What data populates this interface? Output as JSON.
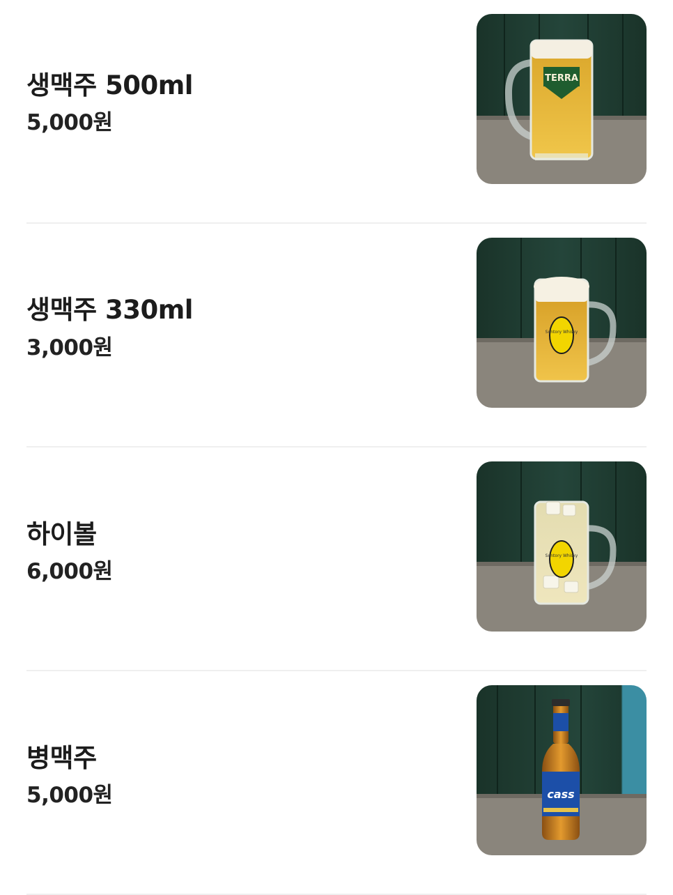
{
  "menu": {
    "items": [
      {
        "name": "생맥주 500ml",
        "price": "5,000원",
        "image_icon": "draft-beer-mug-icon",
        "label_text": "TERRA"
      },
      {
        "name": "생맥주 330ml",
        "price": "3,000원",
        "image_icon": "small-beer-mug-icon",
        "label_text": "Suntory Whisky"
      },
      {
        "name": "하이볼",
        "price": "6,000원",
        "image_icon": "highball-mug-icon",
        "label_text": "Suntory Whisky"
      },
      {
        "name": "병맥주",
        "price": "5,000원",
        "image_icon": "beer-bottle-icon",
        "label_text": "cass"
      }
    ]
  },
  "colors": {
    "wall": "#1f3a30",
    "floor": "#8a857c",
    "beer": "#e8b83a",
    "divider": "#efefef"
  }
}
